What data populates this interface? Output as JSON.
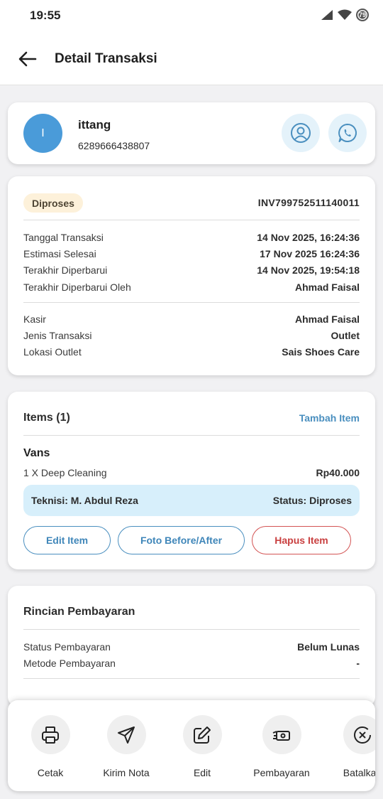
{
  "status_bar": {
    "time": "19:55",
    "battery": "79"
  },
  "header": {
    "title": "Detail Transaksi"
  },
  "customer": {
    "initial": "I",
    "name": "ittang",
    "phone": "6289666438807"
  },
  "transaction": {
    "status_badge": "Diproses",
    "invoice": "INV799752511140011",
    "details": [
      {
        "label": "Tanggal Transaksi",
        "value": "14 Nov 2025, 16:24:36"
      },
      {
        "label": "Estimasi Selesai",
        "value": "17 Nov 2025 16:24:36"
      },
      {
        "label": "Terakhir Diperbarui",
        "value": "14 Nov 2025, 19:54:18"
      },
      {
        "label": "Terakhir Diperbarui Oleh",
        "value": "Ahmad Faisal"
      }
    ],
    "extra": [
      {
        "label": "Kasir",
        "value": "Ahmad Faisal"
      },
      {
        "label": "Jenis Transaksi",
        "value": "Outlet"
      },
      {
        "label": "Lokasi Outlet",
        "value": "Sais Shoes Care"
      }
    ]
  },
  "items": {
    "title": "Items (1)",
    "add_label": "Tambah Item",
    "list": [
      {
        "name": "Vans",
        "service": "1 X Deep Cleaning",
        "price": "Rp40.000",
        "technician": "Teknisi: M. Abdul Reza",
        "status": "Status: Diproses",
        "edit_label": "Edit Item",
        "photo_label": "Foto Before/After",
        "delete_label": "Hapus Item"
      }
    ]
  },
  "payment": {
    "title": "Rincian Pembayaran",
    "rows": [
      {
        "label": "Status Pembayaran",
        "value": "Belum Lunas"
      },
      {
        "label": "Metode Pembayaran",
        "value": "-"
      }
    ]
  },
  "actions": [
    {
      "label": "Cetak",
      "icon": "printer-icon"
    },
    {
      "label": "Kirim Nota",
      "icon": "send-icon"
    },
    {
      "label": "Edit",
      "icon": "edit-icon"
    },
    {
      "label": "Pembayaran",
      "icon": "payment-icon"
    },
    {
      "label": "Batalkan",
      "icon": "cancel-icon"
    }
  ],
  "colors": {
    "accent": "#4a8fbf",
    "avatar": "#4a9bd9",
    "danger": "#c94040",
    "badge_bg": "#fdf1da",
    "tech_bg": "#d7effb"
  }
}
